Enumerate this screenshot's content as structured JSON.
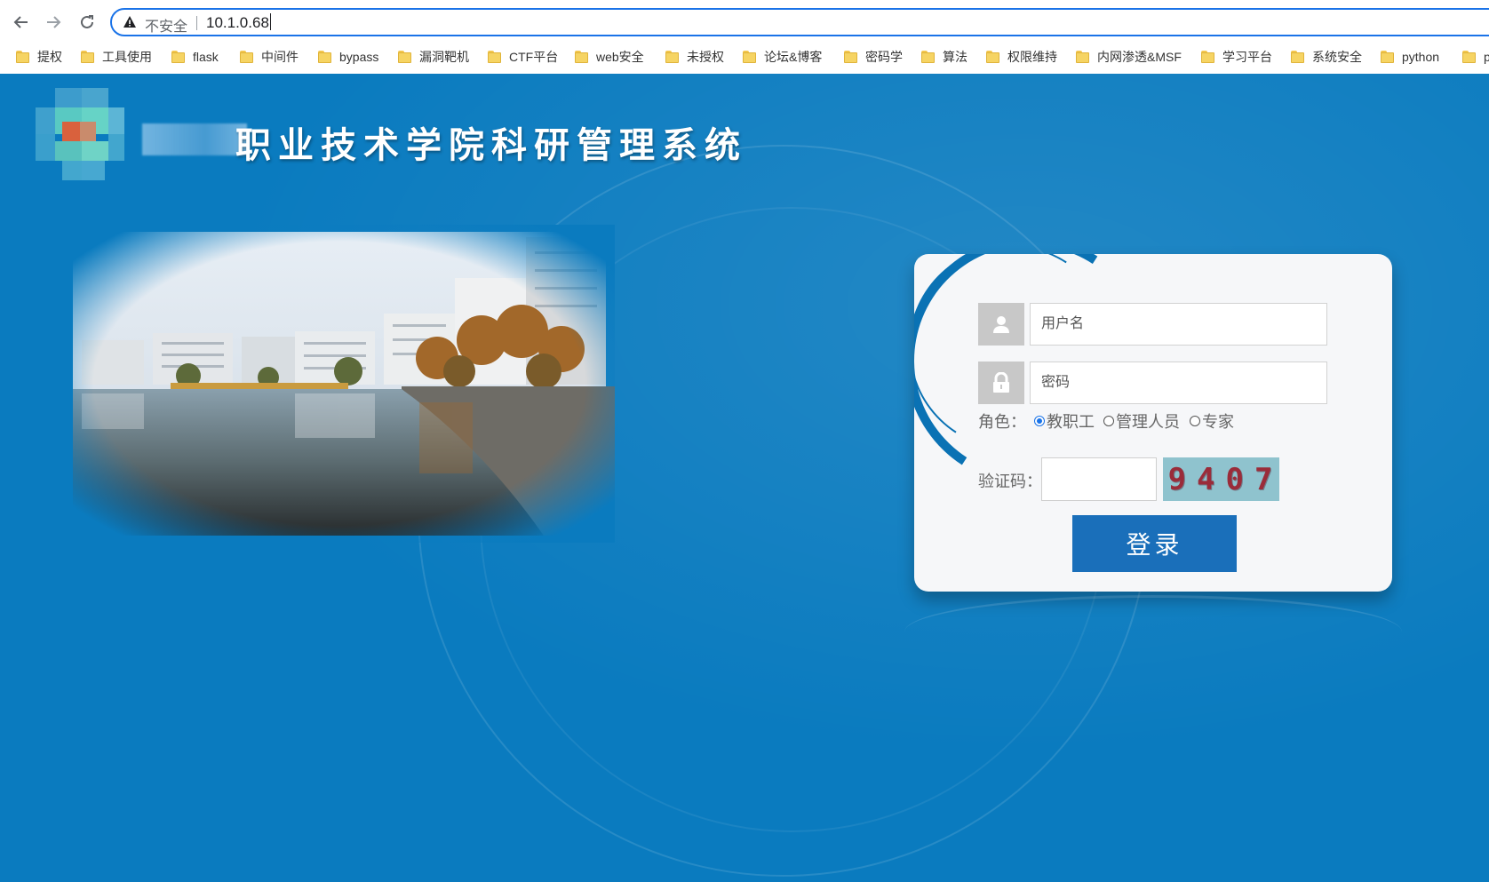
{
  "browser": {
    "insecure_label": "不安全",
    "url": "10.1.0.68",
    "bookmarks": [
      {
        "label": "提权"
      },
      {
        "label": "工具使用"
      },
      {
        "label": "flask"
      },
      {
        "label": "中间件"
      },
      {
        "label": "bypass"
      },
      {
        "label": "漏洞靶机"
      },
      {
        "label": "CTF平台"
      },
      {
        "label": "web安全"
      },
      {
        "label": "未授权"
      },
      {
        "label": "论坛&博客"
      },
      {
        "label": "密码学"
      },
      {
        "label": "算法"
      },
      {
        "label": "权限维持"
      },
      {
        "label": "内网渗透&MSF"
      },
      {
        "label": "学习平台"
      },
      {
        "label": "系统安全"
      },
      {
        "label": "python"
      },
      {
        "label": "p"
      }
    ]
  },
  "header": {
    "title": "职业技术学院科研管理系统"
  },
  "login": {
    "username_placeholder": "用户名",
    "password_placeholder": "密码",
    "role_label": "角色：",
    "roles": [
      {
        "label": "教职工",
        "selected": true
      },
      {
        "label": "管理人员",
        "selected": false
      },
      {
        "label": "专家",
        "selected": false
      }
    ],
    "captcha_label": "验证码：",
    "captcha_code": "9407",
    "login_button": "登录"
  },
  "colors": {
    "page_background": "#0a7bbf",
    "button": "#1a6fba",
    "card": "#f6f7f9",
    "captcha_bg": "#8fc3ce"
  }
}
